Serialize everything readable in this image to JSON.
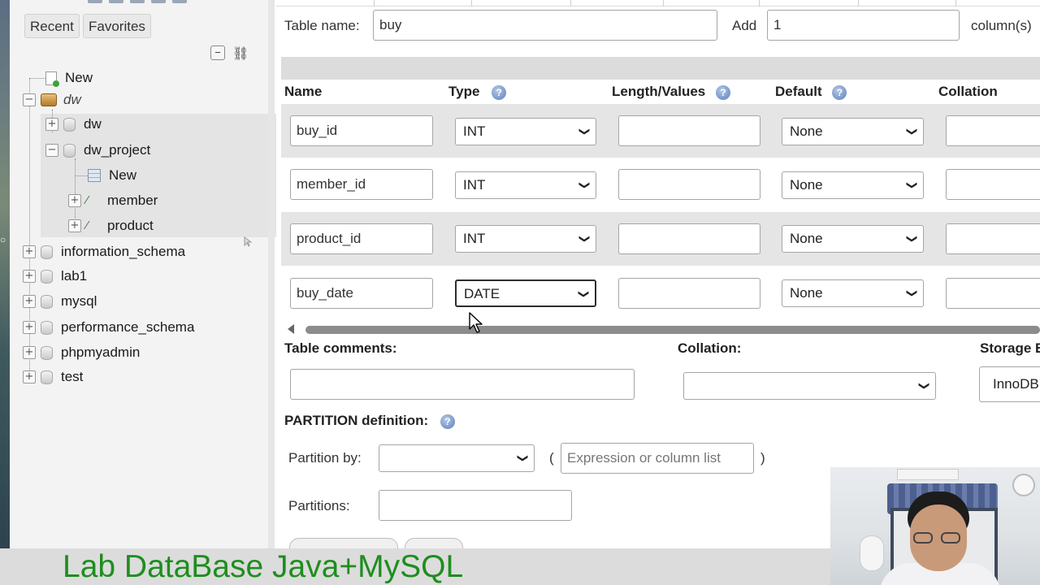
{
  "sidebar": {
    "tabs": {
      "recent": "Recent",
      "favorites": "Favorites"
    },
    "collapse_all_icon": "minus-icon",
    "link_icon": "link-icon",
    "tree": {
      "new_root": "New",
      "dw_group": "dw",
      "dw": "dw",
      "dw_project": "dw_project",
      "dw_project_new": "New",
      "member": "member",
      "product": "product",
      "information_schema": "information_schema",
      "lab1": "lab1",
      "mysql": "mysql",
      "performance_schema": "performance_schema",
      "phpmyadmin": "phpmyadmin",
      "test": "test"
    }
  },
  "form": {
    "table_name_label": "Table name:",
    "table_name_value": "buy",
    "add_label": "Add",
    "add_value": "1",
    "columns_label": "column(s)",
    "headers": {
      "name": "Name",
      "type": "Type",
      "length": "Length/Values",
      "default": "Default",
      "collation": "Collation"
    },
    "rows": [
      {
        "name": "buy_id",
        "type": "INT",
        "length": "",
        "default": "None"
      },
      {
        "name": "member_id",
        "type": "INT",
        "length": "",
        "default": "None"
      },
      {
        "name": "product_id",
        "type": "INT",
        "length": "",
        "default": "None"
      },
      {
        "name": "buy_date",
        "type": "DATE",
        "length": "",
        "default": "None"
      }
    ],
    "table_comments_label": "Table comments:",
    "table_comments_value": "",
    "collation_label": "Collation:",
    "collation_value": "",
    "storage_label": "Storage E",
    "storage_value": "InnoDB",
    "partition_label": "PARTITION definition:",
    "partition_by_label": "Partition by:",
    "partition_by_value": "",
    "paren_open": "(",
    "paren_close": ")",
    "expression_placeholder": "Expression or column list",
    "partitions_label": "Partitions:",
    "partitions_value": ""
  },
  "banner": {
    "text": "Lab DataBase Java+MySQL"
  },
  "colors": {
    "banner_text": "#1e8e1e",
    "row_band": "#e5e5e5",
    "help_icon": "#5a7fb8"
  }
}
